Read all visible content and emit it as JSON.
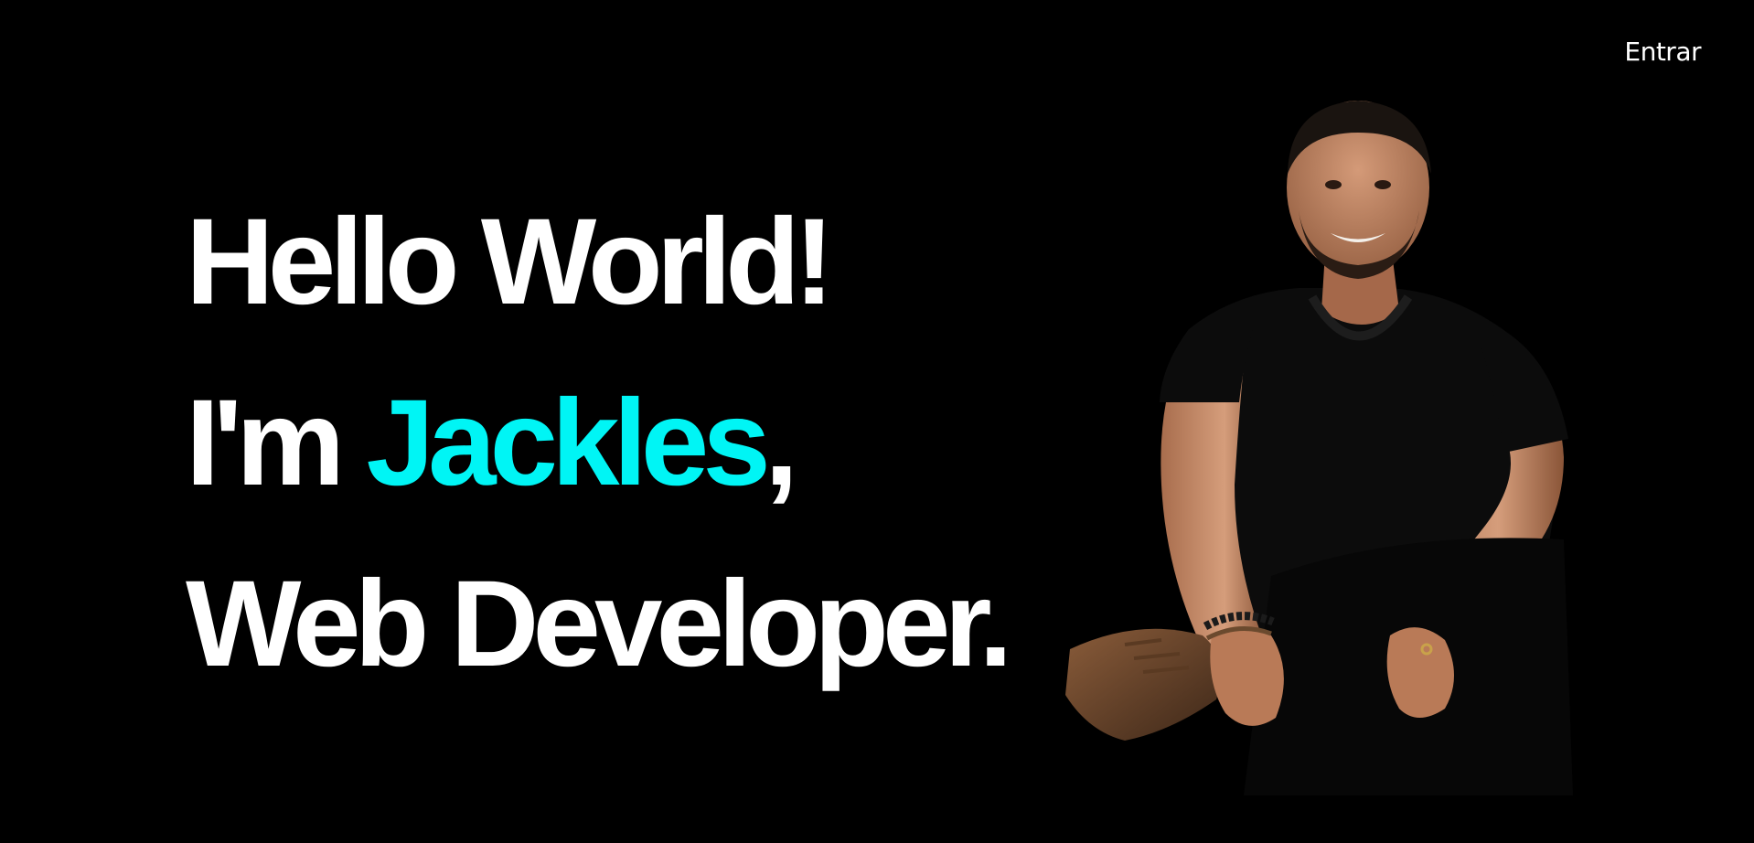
{
  "header": {
    "login_label": "Entrar"
  },
  "hero": {
    "line1": "Hello World!",
    "line2_prefix": "I'm ",
    "line2_name": "Jackles",
    "line2_suffix": ",",
    "line3": "Web Developer."
  },
  "colors": {
    "background": "#000000",
    "text": "#ffffff",
    "accent": "#00f5f5"
  },
  "icons": {
    "portrait": "profile-photo"
  }
}
